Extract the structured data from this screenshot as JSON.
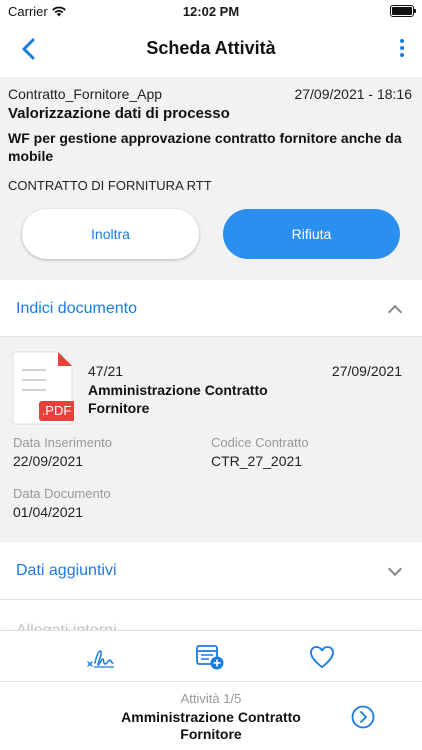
{
  "status_bar": {
    "carrier": "Carrier",
    "time": "12:02 PM"
  },
  "nav": {
    "title": "Scheda Attività",
    "back_icon": "chevron-left-icon",
    "more_icon": "vertical-dots-icon"
  },
  "activity": {
    "app_name": "Contratto_Fornitore_App",
    "datetime": "27/09/2021 - 18:16",
    "process_title": "Valorizzazione dati di processo",
    "description": "WF per gestione approvazione contratto fornitore anche da mobile",
    "contract_type": "CONTRATTO DI FORNITURA RTT",
    "forward_label": "Inoltra",
    "reject_label": "Rifiuta"
  },
  "sections": {
    "indici_title": "Indici documento",
    "dati_title": "Dati aggiuntivi",
    "allegati_title": "Allegati interni"
  },
  "document": {
    "icon_label": ".PDF",
    "number": "47/21",
    "date": "27/09/2021",
    "title": "Amministrazione Contratto Fornitore",
    "fields": [
      {
        "label": "Data Inserimento",
        "value": "22/09/2021"
      },
      {
        "label": "Codice Contratto",
        "value": "CTR_27_2021"
      },
      {
        "label": "Data Documento",
        "value": "01/04/2021"
      }
    ]
  },
  "toolbar": {
    "icons": [
      "signature-icon",
      "add-calendar-icon",
      "heart-icon"
    ]
  },
  "footer": {
    "counter": "Attività 1/5",
    "title": "Amministrazione Contratto Fornitore",
    "next_icon": "chevron-right-circle-icon"
  },
  "colors": {
    "accent": "#1a7be0",
    "primary_button": "#2b8ff0",
    "pdf_red": "#e8403a",
    "panel_bg": "#f2f2f2"
  }
}
